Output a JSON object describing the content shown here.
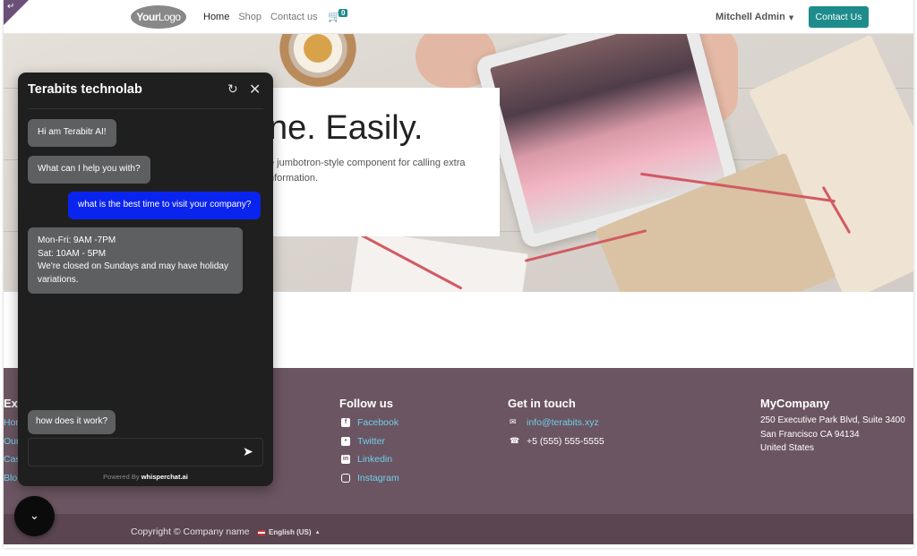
{
  "header": {
    "logo_bold": "Your",
    "logo_light": "Logo",
    "nav": [
      "Home",
      "Shop",
      "Contact us"
    ],
    "cart_count": "0",
    "user": "Mitchell Admin",
    "contact_button": "Contact Us",
    "colors": {
      "accent": "#1f8c8c"
    }
  },
  "hero": {
    "title": "ne. Easily.",
    "subtitle_line1": "e jumbotron-style component for calling extra",
    "subtitle_line2": "nformation."
  },
  "footer": {
    "left_heading": "Exp",
    "left_links": [
      "Hom",
      "Our",
      "Cas",
      "Blo"
    ],
    "follow": {
      "heading": "Follow us",
      "items": [
        {
          "label": "Facebook",
          "icon": "facebook-icon"
        },
        {
          "label": "Twitter",
          "icon": "twitter-icon"
        },
        {
          "label": "Linkedin",
          "icon": "linkedin-icon"
        },
        {
          "label": "Instagram",
          "icon": "instagram-icon"
        }
      ]
    },
    "contact": {
      "heading": "Get in touch",
      "email": "info@terabits.xyz",
      "phone": "+5 (555) 555-5555"
    },
    "company": {
      "heading": "MyCompany",
      "address1": "250 Executive Park Blvd, Suite 3400",
      "address2": "San Francisco CA 94134",
      "address3": "United States"
    },
    "colors": {
      "background": "#6b5562",
      "link": "#6fd0e8"
    }
  },
  "copyright": {
    "text": "Copyright © Company name",
    "language": "English (US)"
  },
  "chat": {
    "title": "Terabits technolab",
    "messages": [
      {
        "role": "bot",
        "text": "Hi am Terabitr AI!"
      },
      {
        "role": "bot",
        "text": "What can I help you with?"
      },
      {
        "role": "user",
        "text": "what is the best time to visit your company?"
      },
      {
        "role": "bot",
        "lines": [
          "Mon-Fri: 9AM -7PM",
          "Sat: 10AM - 5PM",
          "We're closed on Sundays and may have holiday",
          "variations."
        ]
      },
      {
        "role": "bot",
        "text": "how does it work?"
      }
    ],
    "input_value": "",
    "powered_prefix": "Powered By",
    "powered_brand": "whisperchat.ai",
    "colors": {
      "user_bubble": "#0a24ef",
      "bot_bubble": "#5d5f61",
      "panel": "#1f1f1f"
    }
  }
}
